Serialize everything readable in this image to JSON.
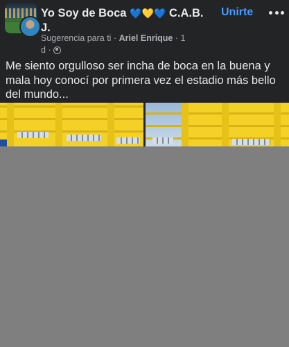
{
  "group": {
    "name": "Yo Soy de Boca",
    "hearts": [
      "💙",
      "💛",
      "💙"
    ],
    "name_suffix": "C.A.B. J.",
    "join_label": "Unirte"
  },
  "meta": {
    "suggestion": "Sugerencia para ti",
    "separator": "·",
    "author": "Ariel Enrique",
    "time": "1 d",
    "privacy_icon": "globe-icon"
  },
  "post": {
    "text": "Me siento orgulloso ser incha de boca en la buena y mala hoy conocí por primera vez el estadio más bello del mundo..."
  },
  "photos": [
    {
      "alt": "yellow-stadium-facade-1"
    },
    {
      "alt": "yellow-stadium-facade-2"
    }
  ],
  "colors": {
    "card_bg": "#232426",
    "accent": "#4a9bff",
    "page_bg": "#7f7f7f",
    "stadium_yellow": "#f4d127"
  }
}
